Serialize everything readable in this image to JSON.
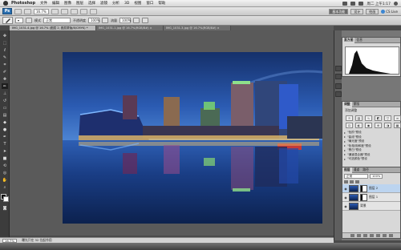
{
  "menubar": {
    "app_name": "Photoshop",
    "items": [
      "文件",
      "编辑",
      "图像",
      "图层",
      "选择",
      "滤镜",
      "分析",
      "3D",
      "视图",
      "窗口",
      "帮助"
    ],
    "clock": "周二 上午1:17"
  },
  "appbar": {
    "logo": "Ps",
    "zoom": "16.7%",
    "workspaces": [
      "基本功能",
      "设计",
      "绘画"
    ],
    "active_workspace": "基本功能",
    "cslive": "CS Live"
  },
  "options": {
    "mode_label": "模式",
    "mode_value": "正常",
    "opacity_label": "不透明度",
    "opacity_value": "100%",
    "flow_label": "流量",
    "flow_value": "100%"
  },
  "window_title": "IMG_1031-4.jpg @ 16.7% (图层 2, 图层蒙版/8/CMYK) *",
  "tabs": [
    {
      "label": "IMG_1031-4.jpg @ 16.7% (图层 2, 图层蒙版/8/CMYK) *",
      "active": true
    },
    {
      "label": "IMG_1031-1.jpg @ 16.7%(RGB/8#) ×",
      "active": false
    },
    {
      "label": "IMG_1031-3.jpg @ 16.7%(RGB/8#) ×",
      "active": false
    }
  ],
  "toolbox_icons": [
    "move-icon",
    "marquee-icon",
    "lasso-icon",
    "quick-select-icon",
    "crop-icon",
    "eyedropper-icon",
    "healing-icon",
    "brush-icon",
    "stamp-icon",
    "history-brush-icon",
    "eraser-icon",
    "gradient-icon",
    "blur-icon",
    "dodge-icon",
    "pen-icon",
    "type-icon",
    "path-select-icon",
    "shape-icon",
    "3d-rotate-icon",
    "3d-orbit-icon",
    "hand-icon",
    "zoom-icon"
  ],
  "statusbar": {
    "zoom": "16.7%",
    "info": "曝光只在 32 位起作用"
  },
  "panels": {
    "histogram_tabs": [
      "直方图",
      "信息"
    ],
    "adjust_tabs": [
      "调整",
      "蒙版"
    ],
    "adjust_title": "添加调整",
    "presets": [
      "\"色阶\"预设",
      "\"曲线\"预设",
      "\"曝光度\"预设",
      "\"色相/饱和度\"预设",
      "\"黑白\"预设",
      "\"通道混合器\"预设",
      "\"可选颜色\"预设"
    ],
    "layers_tabs": [
      "图层",
      "通道",
      "路径"
    ],
    "blend_mode": "正常",
    "opacity": "100%",
    "layers": [
      {
        "name": "图层 2",
        "selected": true,
        "mask": true
      },
      {
        "name": "图层 1",
        "selected": false,
        "mask": true
      },
      {
        "name": "背景",
        "selected": false,
        "mask": false
      }
    ]
  },
  "colors": {
    "sky_top": "#1b3f86",
    "sky_horizon": "#3a6cc4",
    "water": "#123068",
    "selected_layer": "#bcd4ef"
  }
}
